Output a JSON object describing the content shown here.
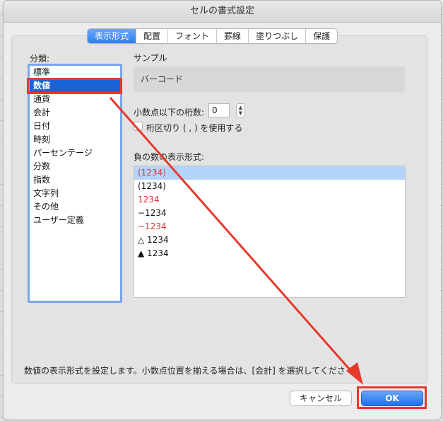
{
  "window": {
    "title": "セルの書式設定"
  },
  "tabs": [
    {
      "label": "表示形式",
      "active": true
    },
    {
      "label": "配置",
      "active": false
    },
    {
      "label": "フォント",
      "active": false
    },
    {
      "label": "罫線",
      "active": false
    },
    {
      "label": "塗りつぶし",
      "active": false
    },
    {
      "label": "保護",
      "active": false
    }
  ],
  "category": {
    "label": "分類:",
    "items": [
      {
        "label": "標準"
      },
      {
        "label": "数値",
        "selected": true
      },
      {
        "label": "通貨"
      },
      {
        "label": "会計"
      },
      {
        "label": "日付"
      },
      {
        "label": "時刻"
      },
      {
        "label": "パーセンテージ"
      },
      {
        "label": "分数"
      },
      {
        "label": "指数"
      },
      {
        "label": "文字列"
      },
      {
        "label": "その他"
      },
      {
        "label": "ユーザー定義"
      }
    ]
  },
  "sample": {
    "label": "サンプル",
    "value": "バーコード"
  },
  "decimals": {
    "label": "小数点以下の桁数:",
    "value": "0"
  },
  "separator": {
    "label": "桁区切り ( , ) を使用する",
    "checked": false
  },
  "negative": {
    "label": "負の数の表示形式:",
    "items": [
      {
        "text": "(1234)",
        "color": "#d23a3a",
        "selected": true
      },
      {
        "text": "(1234)",
        "color": "#111111"
      },
      {
        "text": "1234",
        "color": "#d23a3a"
      },
      {
        "text": "−1234",
        "color": "#111111"
      },
      {
        "text": "−1234",
        "color": "#d23a3a"
      },
      {
        "text": "△ 1234",
        "color": "#111111"
      },
      {
        "text": "▲ 1234",
        "color": "#111111"
      }
    ]
  },
  "description": "数値の表示形式を設定します。小数点位置を揃える場合は、[会計] を選択してくださ い",
  "buttons": {
    "cancel": "キャンセル",
    "ok": "OK"
  },
  "annotation": {
    "color": "#e53a2c"
  }
}
